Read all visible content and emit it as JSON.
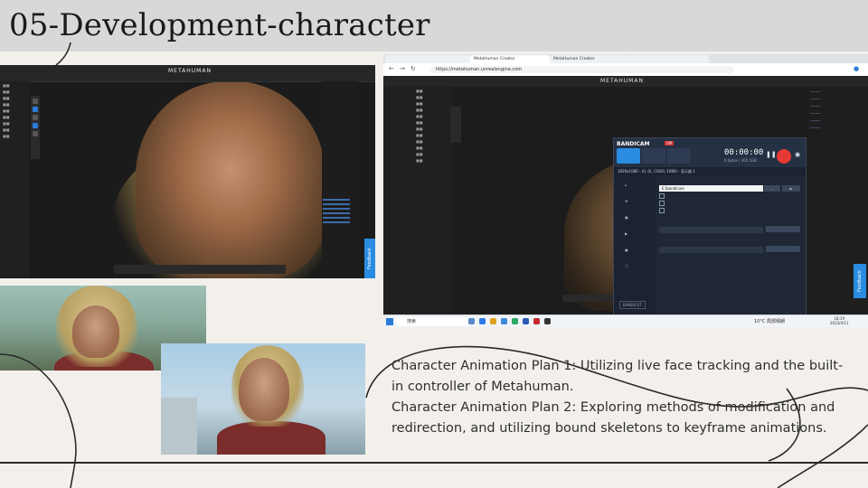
{
  "slide": {
    "title": "05-Development-character",
    "description_lines": [
      "Character Animation Plan 1: Utilizing live face tracking and the built-in controller of Metahuman.",
      "Character Animation Plan 2: Exploring methods of modification and redirection, and utilizing bound skeletons to keyframe animations."
    ]
  },
  "metahuman_left": {
    "brand": "METAHUMAN",
    "feedback_label": "Feedback"
  },
  "browser": {
    "tabs": [
      "MetaHuman Creator",
      "MetaHuman Creator"
    ],
    "url": "https://metahuman.unrealengine.com",
    "brand": "METAHUMAN",
    "feedback_label": "Feedback"
  },
  "bandicam": {
    "logo": "BANDICAM",
    "vip": "VIP",
    "timer": "00:00:00",
    "size": "0 bytes / 305.5GB",
    "resolution": "1920x1080 - (0, 0), (1920, 1080) - 显示器 1",
    "output_path": "E:\\bandicam",
    "brand_footer": "BANDICUT"
  },
  "taskbar": {
    "search": "搜索",
    "weather": "10°C 局部晴朗",
    "time": "18:19",
    "date": "2023/4/11"
  },
  "colors": {
    "title_band": "#d8d8d8",
    "background": "#f3f0ec",
    "accent_blue": "#2a8ce0",
    "record_red": "#e53935"
  }
}
